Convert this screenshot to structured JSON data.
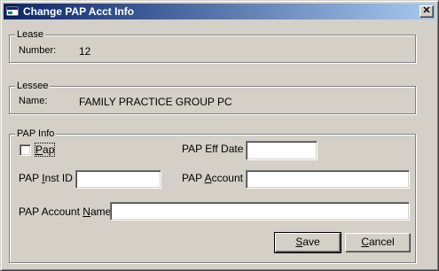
{
  "window": {
    "title": "Change PAP Acct Info",
    "close_glyph": "✕"
  },
  "lease": {
    "group_label": "Lease",
    "number_label": "Number:",
    "number_value": "12"
  },
  "lessee": {
    "group_label": "Lessee",
    "name_label": "Name:",
    "name_value": "FAMILY PRACTICE GROUP PC"
  },
  "pap_info": {
    "group_label": "PAP Info",
    "pap_checkbox": {
      "label_hotkey": "P",
      "label_rest": "ap",
      "checked": false
    },
    "eff_date": {
      "label": "PAP Eff Date :",
      "value": ""
    },
    "inst_id": {
      "label_prefix": "PAP ",
      "label_hotkey": "I",
      "label_rest": "nst ID :",
      "value": ""
    },
    "account": {
      "label_prefix": "PAP ",
      "label_hotkey": "A",
      "label_rest": "ccount :",
      "value": ""
    },
    "account_name": {
      "label_prefix": "PAP Account ",
      "label_hotkey": "N",
      "label_rest": "ame:",
      "value": ""
    }
  },
  "buttons": {
    "save": {
      "hotkey": "S",
      "rest": "ave"
    },
    "cancel": {
      "hotkey": "C",
      "rest": "ancel"
    }
  }
}
